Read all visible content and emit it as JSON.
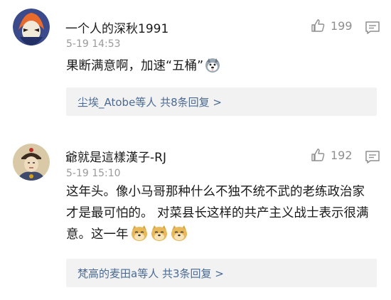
{
  "comments": [
    {
      "username": "一个人的深秋1991",
      "time": "5-19 14:53",
      "likes": "199",
      "text": "果断满意啊，加速“五桶”",
      "replies": "尘埃_Atobe等人 共8条回复 >"
    },
    {
      "username": "爺就是這樣漢子-RJ",
      "time": "5-19 15:10",
      "likes": "192",
      "text": "这年头。像小马哥那种什么不独不统不武的老练政治家才是最可怕的。 对菜县长这样的共产主义战士表示很满意。这一年",
      "replies": "梵高的麦田a等人 共3条回复 >"
    }
  ],
  "icons": {
    "like": "thumbs-up-icon",
    "reply": "comment-icon",
    "emoji_husky": "husky-emoji",
    "emoji_doge": "doge-emoji"
  }
}
